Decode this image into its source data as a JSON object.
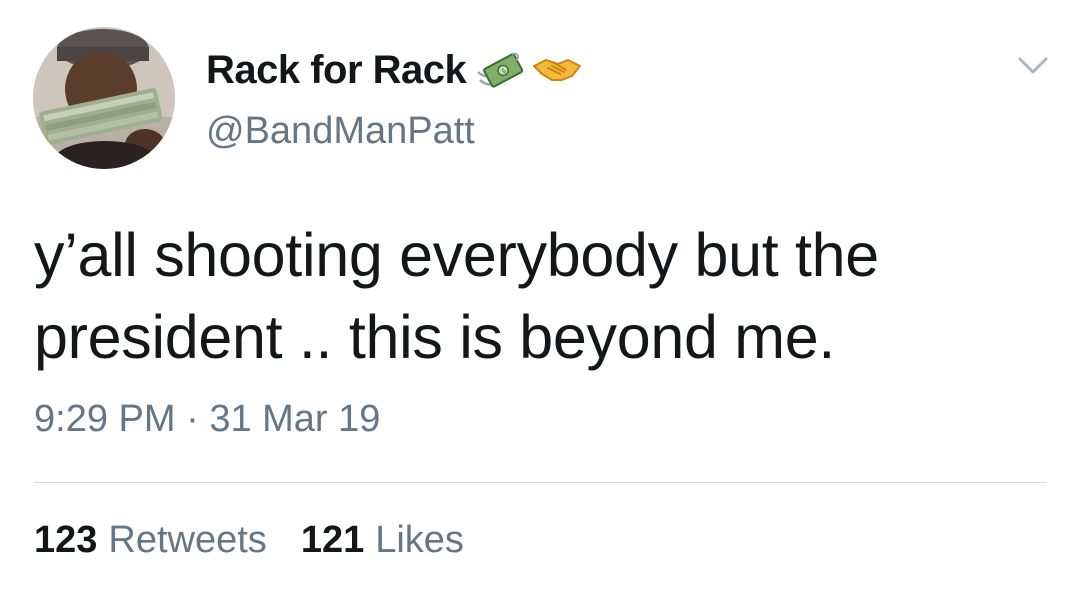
{
  "tweet": {
    "author": {
      "display_name": "Rack for Rack",
      "handle": "@BandManPatt",
      "name_emojis": [
        "money-with-wings-icon",
        "handshake-icon"
      ]
    },
    "text_lines": [
      "y’all shooting everybody but the",
      "president .. this is beyond me."
    ],
    "time": "9:29 PM",
    "separator": "·",
    "date": "31 Mar 19",
    "stats": {
      "retweets_count": "123",
      "retweets_label": "Retweets",
      "likes_count": "121",
      "likes_label": "Likes"
    }
  },
  "colors": {
    "text_primary": "#14171a",
    "text_secondary": "#657786",
    "divider": "#d6dbdf",
    "background": "#ffffff"
  }
}
